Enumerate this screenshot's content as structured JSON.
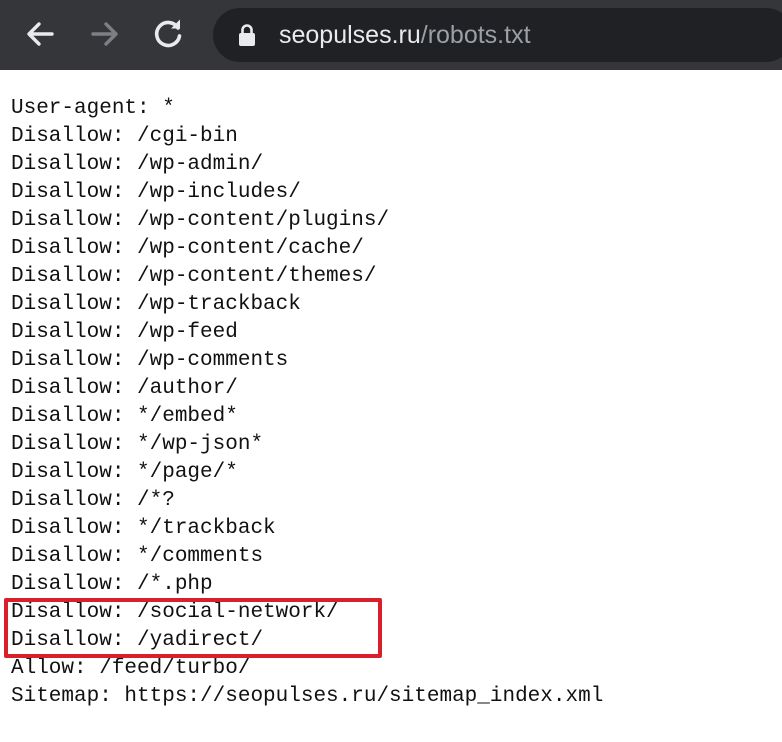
{
  "browser": {
    "url_host": "seopulses.ru",
    "url_path": "/robots.txt",
    "back_icon": "arrow-left-icon",
    "forward_icon": "arrow-right-icon",
    "reload_icon": "reload-icon",
    "lock_icon": "lock-icon"
  },
  "lines": [
    "User-agent: *",
    "Disallow: /cgi-bin",
    "Disallow: /wp-admin/",
    "Disallow: /wp-includes/",
    "Disallow: /wp-content/plugins/",
    "Disallow: /wp-content/cache/",
    "Disallow: /wp-content/themes/",
    "Disallow: /wp-trackback",
    "Disallow: /wp-feed",
    "Disallow: /wp-comments",
    "Disallow: /author/",
    "Disallow: */embed*",
    "Disallow: */wp-json*",
    "Disallow: */page/*",
    "Disallow: /*?",
    "Disallow: */trackback",
    "Disallow: */comments",
    "Disallow: /*.php",
    "Disallow: /social-network/",
    "Disallow: /yadirect/",
    "Allow: /feed/turbo/",
    "Sitemap: https://seopulses.ru/sitemap_index.xml"
  ],
  "colors": {
    "toolbar": "#35363a",
    "omnibox": "#202124",
    "highlight": "#d9202a"
  }
}
